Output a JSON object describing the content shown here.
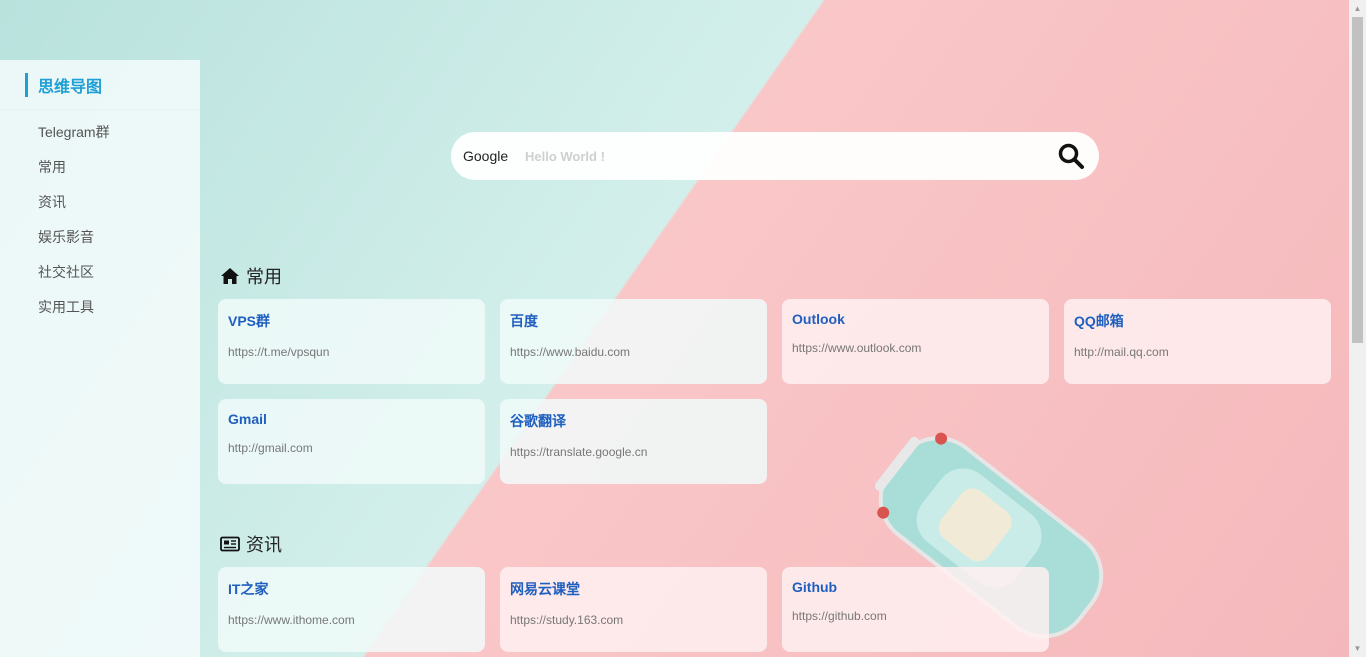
{
  "sidebar": {
    "title": "思维导图",
    "items": [
      {
        "label": "Telegram群"
      },
      {
        "label": "常用"
      },
      {
        "label": "资讯"
      },
      {
        "label": "娱乐影音"
      },
      {
        "label": "社交社区"
      },
      {
        "label": "实用工具"
      }
    ]
  },
  "search": {
    "engine": "Google",
    "placeholder": "Hello World !",
    "button_icon": "search-icon"
  },
  "sections": [
    {
      "title": "常用",
      "icon": "home-icon",
      "cards": [
        {
          "name": "VPS群",
          "url": "https://t.me/vpsqun"
        },
        {
          "name": "百度",
          "url": "https://www.baidu.com"
        },
        {
          "name": "Outlook",
          "url": "https://www.outlook.com"
        },
        {
          "name": "QQ邮箱",
          "url": "http://mail.qq.com"
        },
        {
          "name": "Gmail",
          "url": "http://gmail.com"
        },
        {
          "name": "谷歌翻译",
          "url": "https://translate.google.cn"
        }
      ]
    },
    {
      "title": "资讯",
      "icon": "newspaper-icon",
      "cards": [
        {
          "name": "IT之家",
          "url": "https://www.ithome.com"
        },
        {
          "name": "网易云课堂",
          "url": "https://study.163.com"
        },
        {
          "name": "Github",
          "url": "https://github.com"
        }
      ]
    }
  ],
  "colors": {
    "accent": "#1e9fd6",
    "link": "#1f5fbf",
    "mint": "#cdeeea",
    "pink": "#f7bcbf"
  }
}
